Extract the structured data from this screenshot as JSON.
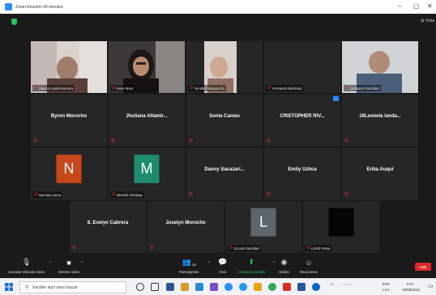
{
  "window": {
    "title": "Zoom Reunión 40 minutos",
    "minimize": "–",
    "maximize": "▢",
    "close": "✕",
    "view_label": "Vista"
  },
  "tiles": [
    {
      "name": "Steven Landel Herrera",
      "video": true,
      "active": false
    },
    {
      "name": "Irene Mora",
      "video": true,
      "active": true
    },
    {
      "name": "Jennifer Marguecho",
      "video": true,
      "active": false
    },
    {
      "name": "Fernanda Minchala",
      "video": false,
      "active": false
    },
    {
      "name": "15.Marco González",
      "video": true,
      "active": false
    },
    {
      "name": "Byron Morocho",
      "video": false
    },
    {
      "name": "Jhuliana Altamir...",
      "video": false
    },
    {
      "name": "Sonia Camas",
      "video": false
    },
    {
      "name": "CRISTOPHER RIV...",
      "video": false,
      "sharing": true
    },
    {
      "name": "16Leonela landa...",
      "video": false
    },
    {
      "name": "Narcisa Lanna",
      "avatar_letter": "N",
      "avatar_color": "#c8471a"
    },
    {
      "name": "Michelli Chimbay",
      "avatar_letter": "M",
      "avatar_color": "#1e8c6e"
    },
    {
      "name": "Danny Sacazari...",
      "video": false
    },
    {
      "name": "Emily Uzhca",
      "video": false
    },
    {
      "name": "Erika Auqui",
      "video": false
    },
    {
      "name": "6. Evelyn Cabrera",
      "video": false
    },
    {
      "name": "Joselyn Morocho",
      "video": false
    },
    {
      "name": "14.Luis González",
      "avatar_letter": "L",
      "avatar_color": "#5d666b"
    },
    {
      "name": "Lizeth Puma",
      "black": true
    }
  ],
  "controls": {
    "mute_label": "Cancelar silenciar ahora",
    "video_label": "Detener video",
    "participants_label": "Participantes",
    "participants_count": "19",
    "chat_label": "Chat",
    "share_label": "Compartir pantalla",
    "record_label": "Grabar",
    "reactions_label": "Reacciones",
    "leave_label": "Salir"
  },
  "taskbar": {
    "search_placeholder": "Escribe aquí para buscar",
    "language": "ESP",
    "region": "LAA",
    "time": "8:27",
    "date": "19/05/2021"
  },
  "colors": {
    "accent": "#2d8cff",
    "active_border": "#e8ec62",
    "leave": "#e02828",
    "mic_off": "#e53935"
  }
}
